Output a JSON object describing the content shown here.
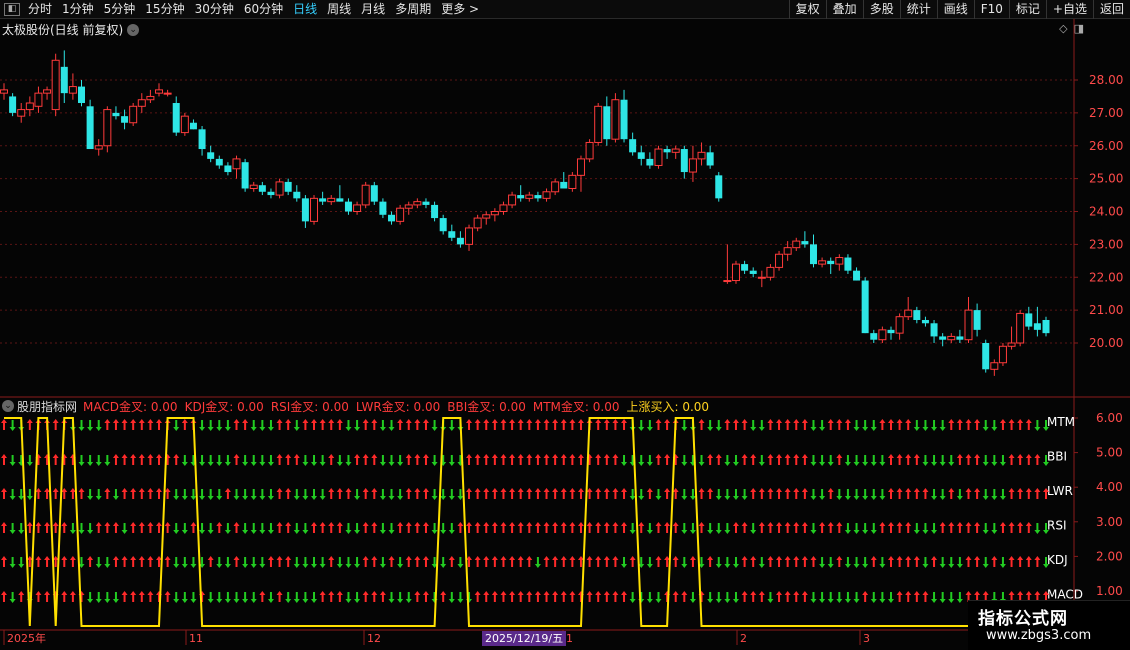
{
  "toolbar": {
    "periods": [
      "分时",
      "1分钟",
      "5分钟",
      "15分钟",
      "30分钟",
      "60分钟",
      "日线",
      "周线",
      "月线",
      "多周期",
      "更多 >"
    ],
    "active_period": "日线",
    "right_buttons": [
      "复权",
      "叠加",
      "多股",
      "统计",
      "画线",
      "F10",
      "标记",
      "+自选",
      "返回"
    ]
  },
  "chart": {
    "title": "太极股份(日线 前复权)",
    "price_axis": [
      "28.00",
      "27.00",
      "26.00",
      "25.00",
      "24.00",
      "23.00",
      "22.00",
      "21.00",
      "20.00"
    ]
  },
  "indicator": {
    "name": "股朋指标网",
    "labels": [
      {
        "text": "MACD金叉: 0.00",
        "color": "#ff3b3b"
      },
      {
        "text": "KDJ金叉: 0.00",
        "color": "#ff3b3b"
      },
      {
        "text": "RSI金叉: 0.00",
        "color": "#ff3b3b"
      },
      {
        "text": "LWR金叉: 0.00",
        "color": "#ff3b3b"
      },
      {
        "text": "BBI金叉: 0.00",
        "color": "#ff3b3b"
      },
      {
        "text": "MTM金叉: 0.00",
        "color": "#ff3b3b"
      },
      {
        "text": "上涨买入: 0.00",
        "color": "#ffd21f"
      }
    ],
    "axis": [
      "6.00",
      "5.00",
      "4.00",
      "3.00",
      "2.00",
      "1.00"
    ],
    "row_labels": [
      "MTM",
      "BBI",
      "LWR",
      "RSI",
      "KDJ",
      "MACD"
    ]
  },
  "date_axis": {
    "labels": [
      "2025年",
      "11",
      "12",
      "1",
      "2",
      "3"
    ],
    "highlight": "2025/12/19/五"
  },
  "watermark": {
    "title": "指标公式网",
    "url": "www.zbgs3.com"
  },
  "colors": {
    "up": "#ff3b3b",
    "down": "#2ee6e6",
    "arrow_up": "#ff2a2a",
    "arrow_down": "#22cc22",
    "signal": "#ffe000",
    "grid": "#5a1515"
  },
  "chart_data": {
    "type": "candlestick",
    "candles_ohlc": [
      [
        27.6,
        27.9,
        27.4,
        27.7
      ],
      [
        27.5,
        27.6,
        26.9,
        27.0
      ],
      [
        26.9,
        27.3,
        26.7,
        27.1
      ],
      [
        27.1,
        27.5,
        26.9,
        27.3
      ],
      [
        27.2,
        27.8,
        27.0,
        27.6
      ],
      [
        27.6,
        27.8,
        27.4,
        27.7
      ],
      [
        27.1,
        28.8,
        26.9,
        28.6
      ],
      [
        28.4,
        28.9,
        27.3,
        27.6
      ],
      [
        27.6,
        28.2,
        27.4,
        27.8
      ],
      [
        27.8,
        28.0,
        27.2,
        27.3
      ],
      [
        27.2,
        27.4,
        26.0,
        25.9
      ],
      [
        25.9,
        26.2,
        25.7,
        26.0
      ],
      [
        26.0,
        27.2,
        25.8,
        27.1
      ],
      [
        27.0,
        27.2,
        26.8,
        26.9
      ],
      [
        26.9,
        27.1,
        26.5,
        26.7
      ],
      [
        26.7,
        27.3,
        26.6,
        27.2
      ],
      [
        27.2,
        27.6,
        27.0,
        27.4
      ],
      [
        27.4,
        27.7,
        27.3,
        27.5
      ],
      [
        27.6,
        27.9,
        27.5,
        27.7
      ],
      [
        27.6,
        27.7,
        27.5,
        27.6
      ],
      [
        27.3,
        27.5,
        26.3,
        26.4
      ],
      [
        26.4,
        27.0,
        26.3,
        26.9
      ],
      [
        26.7,
        26.8,
        26.5,
        26.5
      ],
      [
        26.5,
        26.6,
        25.7,
        25.9
      ],
      [
        25.8,
        26.0,
        25.5,
        25.6
      ],
      [
        25.6,
        25.7,
        25.3,
        25.4
      ],
      [
        25.4,
        25.5,
        25.1,
        25.2
      ],
      [
        25.3,
        25.7,
        25.0,
        25.6
      ],
      [
        25.5,
        25.6,
        24.6,
        24.7
      ],
      [
        24.7,
        24.9,
        24.6,
        24.8
      ],
      [
        24.8,
        24.9,
        24.5,
        24.6
      ],
      [
        24.6,
        24.7,
        24.4,
        24.5
      ],
      [
        24.5,
        25.0,
        24.4,
        24.9
      ],
      [
        24.9,
        25.0,
        24.5,
        24.6
      ],
      [
        24.6,
        24.8,
        24.3,
        24.4
      ],
      [
        24.4,
        24.5,
        23.5,
        23.7
      ],
      [
        23.7,
        24.5,
        23.6,
        24.4
      ],
      [
        24.4,
        24.6,
        24.2,
        24.3
      ],
      [
        24.3,
        24.5,
        24.2,
        24.4
      ],
      [
        24.4,
        24.8,
        24.3,
        24.3
      ],
      [
        24.3,
        24.4,
        23.9,
        24.0
      ],
      [
        24.0,
        24.3,
        23.9,
        24.2
      ],
      [
        24.2,
        24.9,
        24.1,
        24.8
      ],
      [
        24.8,
        24.9,
        24.2,
        24.3
      ],
      [
        24.3,
        24.4,
        23.8,
        23.9
      ],
      [
        23.9,
        24.0,
        23.6,
        23.7
      ],
      [
        23.7,
        24.2,
        23.6,
        24.1
      ],
      [
        24.1,
        24.3,
        23.9,
        24.2
      ],
      [
        24.2,
        24.4,
        24.1,
        24.3
      ],
      [
        24.3,
        24.4,
        24.1,
        24.2
      ],
      [
        24.2,
        24.3,
        23.7,
        23.8
      ],
      [
        23.8,
        23.9,
        23.3,
        23.4
      ],
      [
        23.4,
        23.6,
        23.1,
        23.2
      ],
      [
        23.2,
        23.4,
        22.9,
        23.0
      ],
      [
        23.0,
        23.6,
        22.8,
        23.5
      ],
      [
        23.5,
        23.9,
        23.4,
        23.8
      ],
      [
        23.8,
        24.0,
        23.6,
        23.9
      ],
      [
        23.9,
        24.1,
        23.7,
        24.0
      ],
      [
        24.0,
        24.3,
        23.9,
        24.2
      ],
      [
        24.2,
        24.6,
        24.1,
        24.5
      ],
      [
        24.5,
        24.8,
        24.3,
        24.4
      ],
      [
        24.4,
        24.6,
        24.3,
        24.5
      ],
      [
        24.5,
        24.6,
        24.3,
        24.4
      ],
      [
        24.4,
        24.7,
        24.3,
        24.6
      ],
      [
        24.6,
        25.0,
        24.5,
        24.9
      ],
      [
        24.9,
        25.2,
        24.7,
        24.7
      ],
      [
        24.7,
        25.2,
        24.6,
        25.1
      ],
      [
        25.1,
        25.7,
        24.6,
        25.6
      ],
      [
        25.6,
        26.2,
        25.5,
        26.1
      ],
      [
        26.1,
        27.3,
        26.0,
        27.2
      ],
      [
        27.2,
        27.5,
        26.0,
        26.2
      ],
      [
        26.2,
        27.6,
        26.1,
        27.4
      ],
      [
        27.4,
        27.7,
        26.1,
        26.2
      ],
      [
        26.2,
        26.4,
        25.7,
        25.8
      ],
      [
        25.8,
        26.0,
        25.4,
        25.6
      ],
      [
        25.6,
        25.8,
        25.3,
        25.4
      ],
      [
        25.4,
        26.0,
        25.3,
        25.9
      ],
      [
        25.9,
        26.0,
        25.6,
        25.8
      ],
      [
        25.8,
        26.0,
        25.6,
        25.9
      ],
      [
        25.9,
        26.0,
        25.0,
        25.2
      ],
      [
        25.2,
        26.0,
        24.9,
        25.6
      ],
      [
        25.6,
        26.1,
        25.4,
        25.8
      ],
      [
        25.8,
        26.0,
        25.3,
        25.4
      ],
      [
        25.1,
        25.2,
        24.3,
        24.4
      ],
      [
        21.9,
        23.0,
        21.8,
        21.9
      ],
      [
        21.9,
        22.5,
        21.8,
        22.4
      ],
      [
        22.4,
        22.5,
        22.1,
        22.2
      ],
      [
        22.2,
        22.3,
        22.0,
        22.1
      ],
      [
        22.0,
        22.2,
        21.7,
        22.0
      ],
      [
        22.0,
        22.4,
        21.9,
        22.3
      ],
      [
        22.3,
        22.8,
        22.2,
        22.7
      ],
      [
        22.7,
        23.1,
        22.5,
        22.9
      ],
      [
        22.9,
        23.2,
        22.8,
        23.1
      ],
      [
        23.1,
        23.4,
        22.9,
        23.0
      ],
      [
        23.0,
        23.3,
        22.3,
        22.4
      ],
      [
        22.4,
        22.6,
        22.3,
        22.5
      ],
      [
        22.5,
        22.6,
        22.1,
        22.4
      ],
      [
        22.4,
        22.7,
        22.2,
        22.6
      ],
      [
        22.6,
        22.7,
        22.1,
        22.2
      ],
      [
        22.2,
        22.3,
        21.9,
        21.9
      ],
      [
        21.9,
        22.0,
        20.3,
        20.3
      ],
      [
        20.3,
        20.4,
        20.0,
        20.1
      ],
      [
        20.1,
        20.5,
        20.0,
        20.4
      ],
      [
        20.4,
        20.5,
        20.1,
        20.3
      ],
      [
        20.3,
        20.9,
        20.1,
        20.8
      ],
      [
        20.8,
        21.4,
        20.7,
        21.0
      ],
      [
        21.0,
        21.1,
        20.6,
        20.7
      ],
      [
        20.7,
        20.8,
        20.5,
        20.6
      ],
      [
        20.6,
        20.7,
        20.0,
        20.2
      ],
      [
        20.2,
        20.3,
        19.9,
        20.1
      ],
      [
        20.1,
        20.3,
        20.0,
        20.2
      ],
      [
        20.2,
        20.4,
        20.0,
        20.1
      ],
      [
        20.1,
        21.4,
        20.0,
        21.0
      ],
      [
        21.0,
        21.2,
        20.2,
        20.4
      ],
      [
        20.0,
        20.1,
        19.1,
        19.2
      ],
      [
        19.2,
        19.5,
        19.0,
        19.4
      ],
      [
        19.4,
        20.0,
        19.3,
        19.9
      ],
      [
        19.9,
        20.5,
        19.8,
        20.0
      ],
      [
        20.0,
        21.0,
        19.9,
        20.9
      ],
      [
        20.9,
        21.1,
        20.4,
        20.5
      ],
      [
        20.6,
        21.1,
        20.2,
        20.4
      ],
      [
        20.7,
        20.8,
        20.2,
        20.3
      ]
    ]
  }
}
